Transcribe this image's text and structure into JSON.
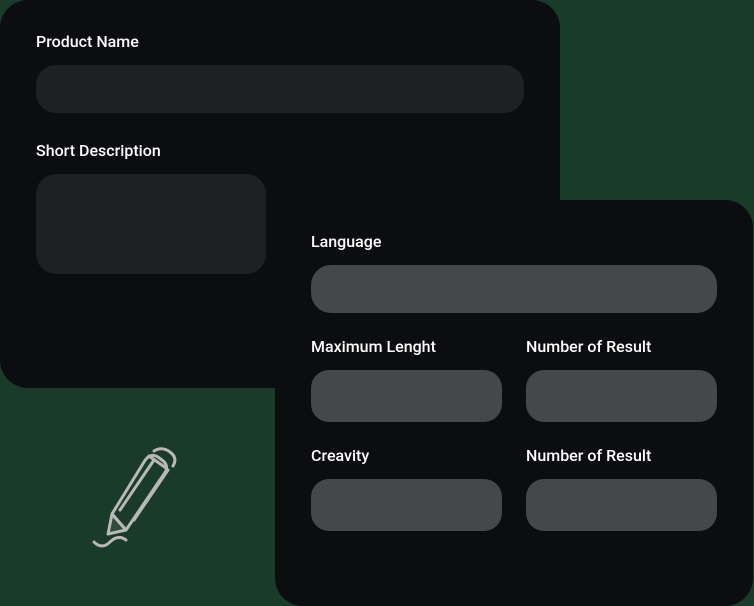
{
  "back": {
    "product_name_label": "Product Name",
    "product_name_value": "",
    "short_description_label": "Short Description",
    "short_description_value": ""
  },
  "front": {
    "language_label": "Language",
    "language_value": "",
    "max_length_label": "Maximum Lenght",
    "max_length_value": "",
    "num_result_1_label": "Number of Result",
    "num_result_1_value": "",
    "creativity_label": "Creavity",
    "creativity_value": "",
    "num_result_2_label": "Number of Result",
    "num_result_2_value": ""
  }
}
